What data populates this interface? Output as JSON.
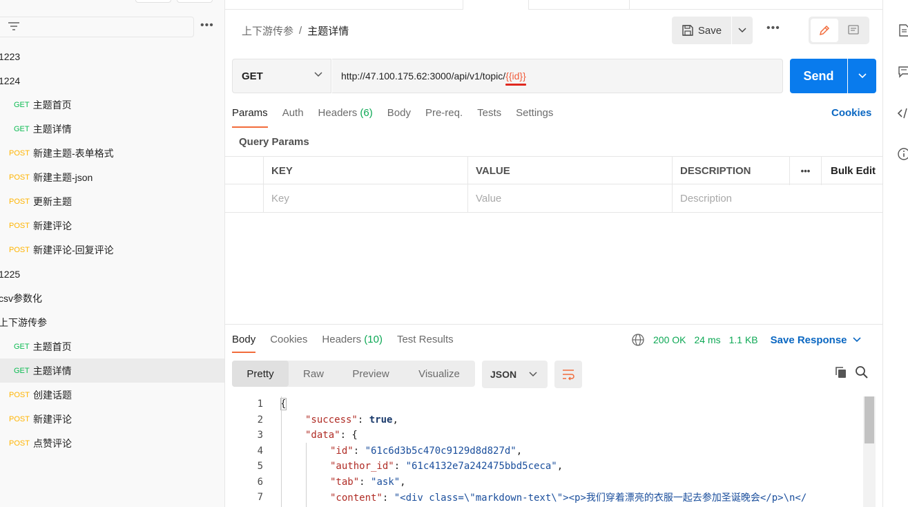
{
  "sidebar": {
    "tree": [
      {
        "type": "folder",
        "label": "1223"
      },
      {
        "type": "folder",
        "label": "1224"
      },
      {
        "type": "req",
        "method": "GET",
        "label": "主题首页"
      },
      {
        "type": "req",
        "method": "GET",
        "label": "主题详情"
      },
      {
        "type": "req",
        "method": "POST",
        "label": "新建主题-表单格式"
      },
      {
        "type": "req",
        "method": "POST",
        "label": "新建主题-json"
      },
      {
        "type": "req",
        "method": "POST",
        "label": "更新主题"
      },
      {
        "type": "req",
        "method": "POST",
        "label": "新建评论"
      },
      {
        "type": "req",
        "method": "POST",
        "label": "新建评论-回复评论"
      },
      {
        "type": "folder",
        "label": "1225"
      },
      {
        "type": "folder",
        "label": "csv参数化"
      },
      {
        "type": "folder",
        "label": "上下游传参"
      },
      {
        "type": "req",
        "method": "GET",
        "label": "主题首页"
      },
      {
        "type": "req",
        "method": "GET",
        "label": "主题详情",
        "active": true
      },
      {
        "type": "req",
        "method": "POST",
        "label": "创建话题"
      },
      {
        "type": "req",
        "method": "POST",
        "label": "新建评论"
      },
      {
        "type": "req",
        "method": "POST",
        "label": "点赞评论"
      }
    ]
  },
  "header": {
    "breadcrumb_parent": "上下游传参",
    "breadcrumb_sep": "/",
    "breadcrumb_current": "主题详情",
    "save_label": "Save"
  },
  "request": {
    "method": "GET",
    "url_prefix": "http://47.100.175.62:3000/api/v1/topic/",
    "url_variable": "{{id}}",
    "send_label": "Send",
    "tabs": {
      "params": "Params",
      "auth": "Auth",
      "headers": "Headers",
      "headers_count": "(6)",
      "body": "Body",
      "prereq": "Pre-req.",
      "tests": "Tests",
      "settings": "Settings"
    },
    "cookies_label": "Cookies",
    "query_params_title": "Query Params",
    "table_headers": {
      "key": "KEY",
      "value": "VALUE",
      "description": "DESCRIPTION",
      "bulk_edit": "Bulk Edit"
    },
    "placeholders": {
      "key": "Key",
      "value": "Value",
      "description": "Description"
    }
  },
  "response": {
    "tabs": {
      "body": "Body",
      "cookies": "Cookies",
      "headers": "Headers",
      "headers_count": "(10)",
      "test_results": "Test Results"
    },
    "status": "200 OK",
    "time": "24 ms",
    "size": "1.1 KB",
    "save_response": "Save Response",
    "views": {
      "pretty": "Pretty",
      "raw": "Raw",
      "preview": "Preview",
      "visualize": "Visualize"
    },
    "format": "JSON",
    "code_lines": [
      {
        "n": "1"
      },
      {
        "n": "2"
      },
      {
        "n": "3"
      },
      {
        "n": "4"
      },
      {
        "n": "5"
      },
      {
        "n": "6"
      },
      {
        "n": "7"
      }
    ],
    "code": {
      "l1": "{",
      "l2_key": "\"success\"",
      "l2_val": "true",
      "l3_key": "\"data\"",
      "l3_rest": ": {",
      "l4_key": "\"id\"",
      "l4_val": "\"61c6d3b5c470c9129d8d827d\"",
      "l5_key": "\"author_id\"",
      "l5_val": "\"61c4132e7a242475bbd5ceca\"",
      "l6_key": "\"tab\"",
      "l6_val": "\"ask\"",
      "l7_key": "\"content\"",
      "l7_val": "\"<div class=\\\"markdown-text\\\"><p>我们穿着漂亮的衣服一起去参加圣诞晚会</p>\\n</"
    }
  },
  "colors": {
    "accent_blue": "#097bed",
    "get_green": "#0cbb52",
    "post_yellow": "#ffb400",
    "tab_underline": "#f26b3a"
  }
}
